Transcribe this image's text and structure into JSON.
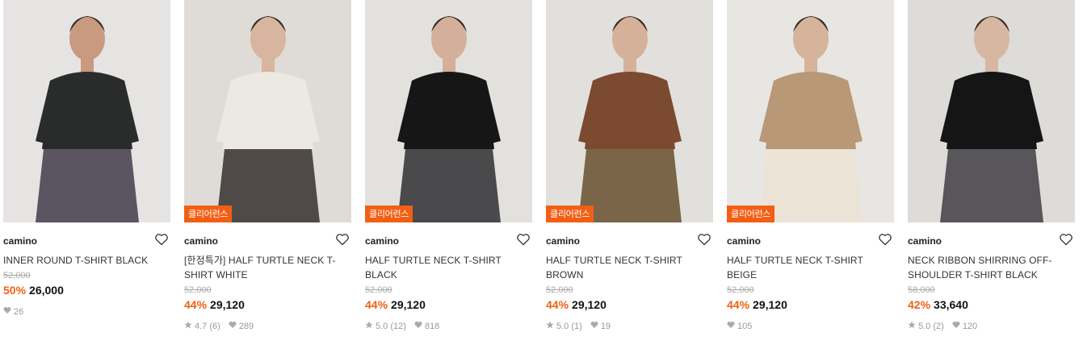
{
  "products": [
    {
      "brand": "camino",
      "name": "INNER ROUND T-SHIRT BLACK",
      "badge": "",
      "original_price": "52,000",
      "discount": "50%",
      "price": "26,000",
      "rating": "",
      "review_count": "",
      "likes": "26",
      "colors": {
        "bg": "#e6e4e2",
        "top": "#2a2c2c",
        "bottom": "#5b5561",
        "skin": "#c99a80"
      }
    },
    {
      "brand": "camino",
      "name": "[한정특가] HALF TURTLE NECK T-SHIRT WHITE",
      "badge": "클리어런스",
      "original_price": "52,000",
      "discount": "44%",
      "price": "29,120",
      "rating": "4.7",
      "review_count": "(6)",
      "likes": "289",
      "colors": {
        "bg": "#dfdcd8",
        "top": "#ece9e3",
        "bottom": "#4f4a47",
        "skin": "#d8b59e"
      }
    },
    {
      "brand": "camino",
      "name": "HALF TURTLE NECK T-SHIRT BLACK",
      "badge": "클리어런스",
      "original_price": "52,000",
      "discount": "44%",
      "price": "29,120",
      "rating": "5.0",
      "review_count": "(12)",
      "likes": "818",
      "colors": {
        "bg": "#e3e1de",
        "top": "#161616",
        "bottom": "#4a4a4c",
        "skin": "#d4b09a"
      }
    },
    {
      "brand": "camino",
      "name": "HALF TURTLE NECK T-SHIRT BROWN",
      "badge": "클리어런스",
      "original_price": "52,000",
      "discount": "44%",
      "price": "29,120",
      "rating": "5.0",
      "review_count": "(1)",
      "likes": "19",
      "colors": {
        "bg": "#e2e0dc",
        "top": "#7b4a30",
        "bottom": "#7a6548",
        "skin": "#d5b19a"
      }
    },
    {
      "brand": "camino",
      "name": "HALF TURTLE NECK T-SHIRT BEIGE",
      "badge": "클리어런스",
      "original_price": "52,000",
      "discount": "44%",
      "price": "29,120",
      "rating": "",
      "review_count": "",
      "likes": "105",
      "colors": {
        "bg": "#e8e6e2",
        "top": "#b99878",
        "bottom": "#ebe3d6",
        "skin": "#d6b39b"
      }
    },
    {
      "brand": "camino",
      "name": "NECK RIBBON SHIRRING OFF-SHOULDER T-SHIRT BLACK",
      "badge": "",
      "original_price": "58,000",
      "discount": "42%",
      "price": "33,640",
      "rating": "5.0",
      "review_count": "(2)",
      "likes": "120",
      "colors": {
        "bg": "#dddcd9",
        "top": "#151515",
        "bottom": "#58565a",
        "skin": "#d7b6a2"
      }
    }
  ],
  "icons": {
    "wishlist": "heart-outline-icon",
    "rating": "star-icon",
    "likes": "heart-filled-icon"
  }
}
